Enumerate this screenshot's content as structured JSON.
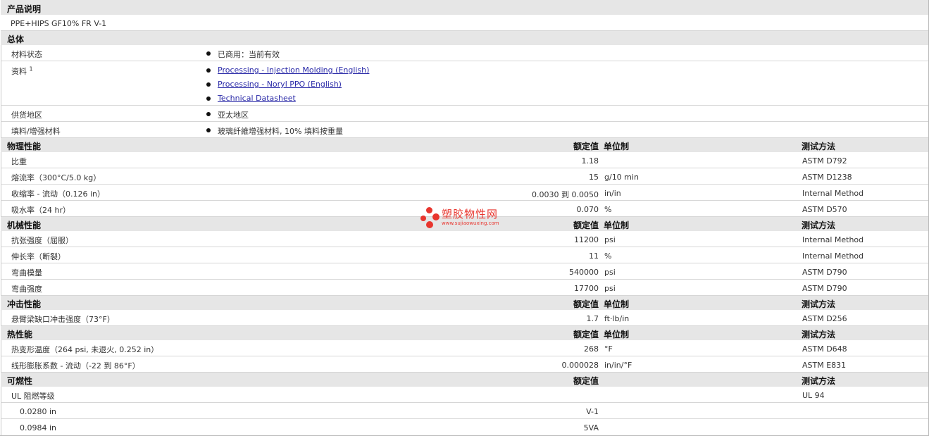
{
  "product": {
    "header": "产品说明",
    "name": "PPE+HIPS GF10% FR V-1"
  },
  "general": {
    "header": "总体",
    "status": {
      "label": "材料状态",
      "value": "已商用：当前有效"
    },
    "docs": {
      "label": "资料",
      "sup": "1",
      "links": [
        "Processing - Injection Molding (English)",
        "Processing - Noryl PPO (English)",
        "Technical Datasheet"
      ]
    },
    "region": {
      "label": "供货地区",
      "value": "亚太地区"
    },
    "filler": {
      "label": "填料/增强材料",
      "value": "玻璃纤維增强材料, 10% 填料按重量"
    }
  },
  "columns": {
    "nominal": "额定值",
    "unit": "单位制",
    "method": "测试方法"
  },
  "physical": {
    "header": "物理性能",
    "rows": [
      {
        "label": "比重",
        "value": "1.18",
        "unit": "",
        "method": "ASTM D792"
      },
      {
        "label": "熔流率（300°C/5.0 kg）",
        "value": "15",
        "unit": "g/10 min",
        "method": "ASTM D1238"
      },
      {
        "label": "收缩率 - 流动（0.126 in）",
        "value": "0.0030 到  0.0050",
        "unit": "in/in",
        "method": "Internal Method"
      },
      {
        "label": "吸水率（24 hr）",
        "value": "0.070",
        "unit": "%",
        "method": "ASTM D570"
      }
    ]
  },
  "mechanical": {
    "header": "机械性能",
    "rows": [
      {
        "label": "抗张强度（屈服）",
        "value": "11200",
        "unit": "psi",
        "method": "Internal Method"
      },
      {
        "label": "伸长率（断裂）",
        "value": "11",
        "unit": "%",
        "method": "Internal Method"
      },
      {
        "label": "弯曲模量",
        "value": "540000",
        "unit": "psi",
        "method": "ASTM D790"
      },
      {
        "label": "弯曲强度",
        "value": "17700",
        "unit": "psi",
        "method": "ASTM D790"
      }
    ]
  },
  "impact": {
    "header": "冲击性能",
    "rows": [
      {
        "label": "悬臂梁缺口冲击强度（73°F）",
        "value": "1.7",
        "unit": "ft·lb/in",
        "method": "ASTM D256"
      }
    ]
  },
  "thermal": {
    "header": "热性能",
    "rows": [
      {
        "label": "热变形温度（264 psi, 未退火, 0.252 in）",
        "value": "268",
        "unit": "°F",
        "method": "ASTM D648"
      },
      {
        "label": "线形膨胀系数 - 流动（-22 到  86°F）",
        "value": "0.000028",
        "unit": "in/in/°F",
        "method": "ASTM E831"
      }
    ]
  },
  "flammability": {
    "header": "可燃性",
    "ul": {
      "label": "UL 阻燃等级",
      "method": "UL 94"
    },
    "rows": [
      {
        "label": "0.0280 in",
        "value": "V-1"
      },
      {
        "label": "0.0984 in",
        "value": "5VA"
      }
    ]
  },
  "watermark": {
    "title": "塑胶物性网",
    "url": "www.sujiaowuxing.com",
    "color": "#e8352e"
  }
}
